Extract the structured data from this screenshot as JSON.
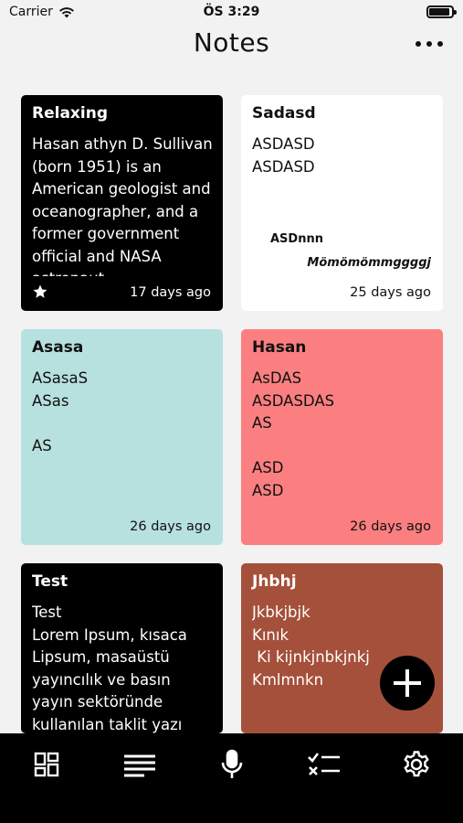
{
  "status": {
    "carrier": "Carrier",
    "time": "ÖS 3:29"
  },
  "header": {
    "title": "Notes",
    "more_icon": "more-horizontal-icon"
  },
  "notes": [
    {
      "title": "Relaxing",
      "body": "Hasan athyn D. Sullivan (born 1951) is an American geologist and oceanographer, and a former government official and NASA astronaut",
      "date": "17 days ago",
      "color": "#000000",
      "starred": true
    },
    {
      "title": "Sadasd",
      "body": "ASDASD\nASDASD",
      "extra_line_1": "ASDnnn",
      "extra_line_2": "Mömömömmggggj",
      "date": "25 days ago",
      "color": "#ffffff"
    },
    {
      "title": "Asasa",
      "body": "ASasaS\nASas\n\nAS",
      "date": "26 days ago",
      "color": "#b7e1df"
    },
    {
      "title": "Hasan",
      "body": "AsDAS\nASDASDAS\nAS\n\nASD\nASD",
      "date": "26 days ago",
      "color": "#fb7f80"
    },
    {
      "title": "Test",
      "body": "Test\nLorem Ipsum, kısaca Lipsum, masaüstü yayıncılık ve basın yayın sektöründe kullanılan taklit yazı",
      "date": "",
      "color": "#000000"
    },
    {
      "title": "Jhbhj",
      "body": "Jkbkjbjk\nKınık\n Ki kijnkjnbkjnkj\nKmlmnkn",
      "date": "",
      "color": "#a5503a"
    }
  ],
  "tabbar": {
    "items": [
      "grid-view-icon",
      "list-view-icon",
      "microphone-icon",
      "checklist-icon",
      "settings-gear-icon"
    ]
  },
  "fab": {
    "icon": "plus-icon"
  }
}
